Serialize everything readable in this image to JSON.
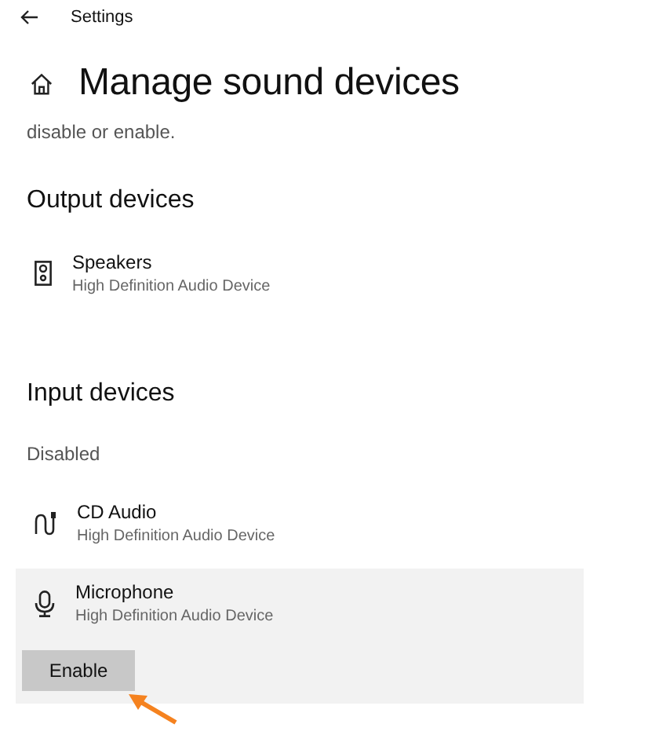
{
  "window": {
    "title": "Settings"
  },
  "page": {
    "title": "Manage sound devices",
    "description": "disable or enable."
  },
  "sections": [
    {
      "heading": "Output devices",
      "devices": [
        {
          "kind": "speaker",
          "name": "Speakers",
          "detail": "High Definition Audio Device",
          "selected": false
        }
      ]
    },
    {
      "heading": "Input devices",
      "subheading": "Disabled",
      "devices": [
        {
          "kind": "jack",
          "name": "CD Audio",
          "detail": "High Definition Audio Device",
          "selected": false
        },
        {
          "kind": "microphone",
          "name": "Microphone",
          "detail": "High Definition Audio Device",
          "selected": true,
          "button": "Enable"
        }
      ]
    }
  ]
}
